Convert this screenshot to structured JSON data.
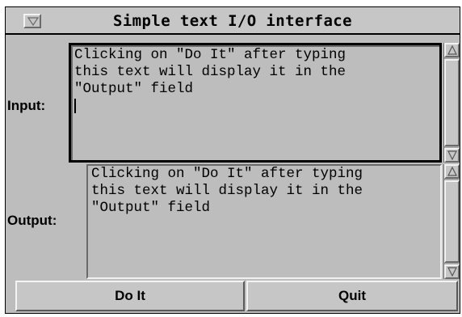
{
  "window": {
    "title": "Simple text I/O interface",
    "menu_icon": "window-menu-triangle-icon"
  },
  "input": {
    "label": "Input:",
    "value": "Clicking on \"Do It\" after typing\nthis text will display it in the\n\"Output\" field"
  },
  "output": {
    "label": "Output:",
    "value": "Clicking on \"Do It\" after typing\nthis text will display it in the\n\"Output\" field"
  },
  "buttons": {
    "do_it": "Do It",
    "quit": "Quit"
  },
  "icons": {
    "scroll_up": "scroll-up-arrow-icon",
    "scroll_down": "scroll-down-arrow-icon"
  }
}
